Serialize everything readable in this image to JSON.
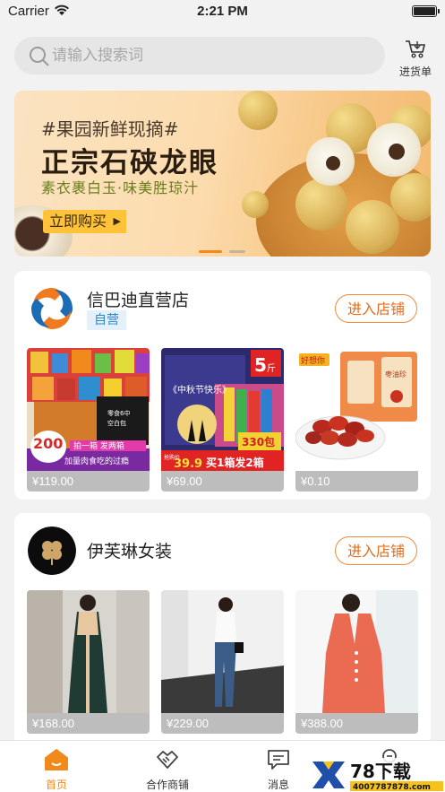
{
  "status_bar": {
    "carrier": "Carrier",
    "time": "2:21 PM"
  },
  "search": {
    "placeholder": "请输入搜索词"
  },
  "header": {
    "purchase_list_label": "进货单"
  },
  "banner": {
    "hashtag": "#果园新鲜现摘#",
    "headline": "正宗石硖龙眼",
    "subline": "素衣裹白玉·味美胜琼汁",
    "button_label": "立即购买",
    "page_count": 2,
    "active_page": 1
  },
  "shops": [
    {
      "name": "信巴迪直营店",
      "badge": "自营",
      "enter_label": "进入店铺",
      "products": [
        {
          "price": "¥119.00",
          "image_text": [
            "200",
            "包",
            "拍一箱 发两箱",
            "加量肉食吃的过瘾",
            "零食6中 空白包"
          ]
        },
        {
          "price": "¥69.00",
          "image_text": [
            "5",
            "斤",
            "《中秋节快乐》",
            "330包",
            "39.9",
            "买1箱发2箱",
            "抢购价"
          ]
        },
        {
          "price": "¥0.10",
          "image_text": [
            "好想你",
            "枣油珍"
          ]
        }
      ]
    },
    {
      "name": "伊芙琳女装",
      "badge": "",
      "enter_label": "进入店铺",
      "products": [
        {
          "price": "¥168.00"
        },
        {
          "price": "¥229.00"
        },
        {
          "price": "¥388.00"
        }
      ]
    }
  ],
  "tab_bar": {
    "tabs": [
      {
        "label": "首页",
        "icon": "home-icon",
        "active": true
      },
      {
        "label": "合作商铺",
        "icon": "handshake-icon",
        "active": false
      },
      {
        "label": "消息",
        "icon": "message-icon",
        "active": false
      },
      {
        "label": "",
        "icon": "user-icon",
        "active": false
      }
    ]
  },
  "watermark": {
    "text": "78下载",
    "url_text": "4007787878.com"
  },
  "colors": {
    "accent": "#f08a1c",
    "badge_blue": "#2f86c9",
    "price_bar": "#bdbdbd"
  }
}
